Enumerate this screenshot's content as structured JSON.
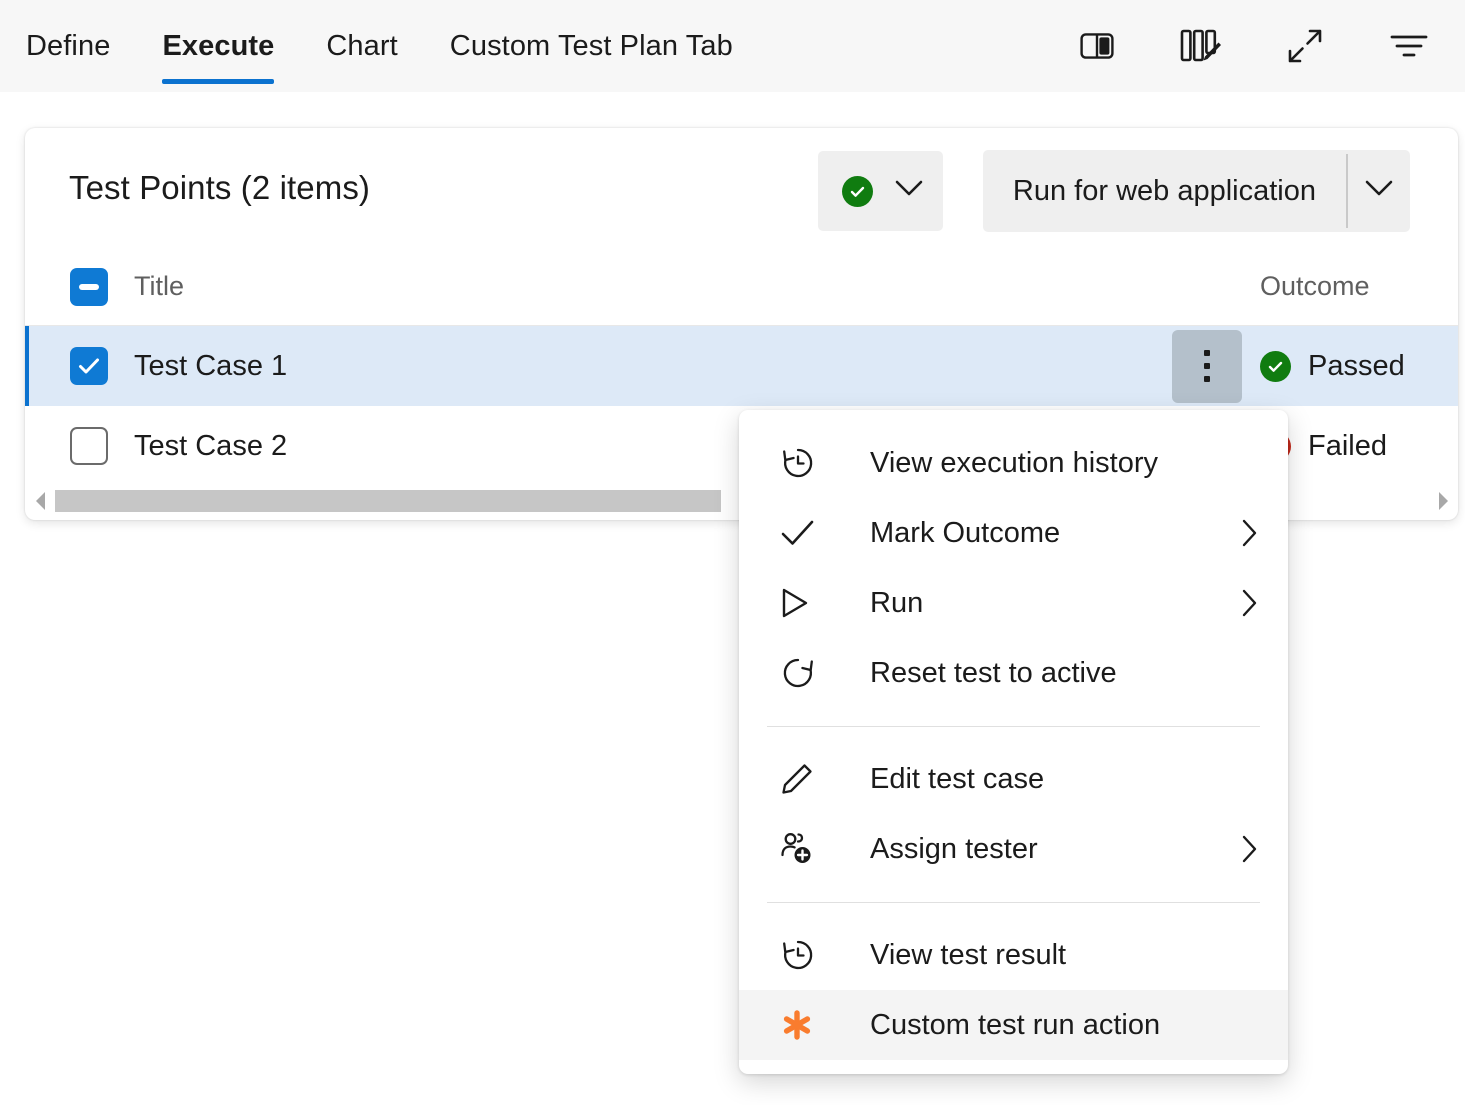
{
  "tabs": [
    {
      "label": "Define",
      "active": false
    },
    {
      "label": "Execute",
      "active": true
    },
    {
      "label": "Chart",
      "active": false
    },
    {
      "label": "Custom Test Plan Tab",
      "active": false
    }
  ],
  "toolbar": {
    "icons": [
      {
        "name": "split-pane-icon",
        "title": "Split pane"
      },
      {
        "name": "column-options-icon",
        "title": "Column options"
      },
      {
        "name": "fullscreen-expand-icon",
        "title": "Full screen"
      },
      {
        "name": "filter-icon",
        "title": "Filter"
      }
    ]
  },
  "card": {
    "title": "Test Points (2 items)",
    "outcome_button": {
      "icon": "passed-outcome-icon",
      "caret": "chevron-down-icon"
    },
    "run_button": {
      "label": "Run for web application",
      "caret": "chevron-down-icon"
    }
  },
  "grid": {
    "columns": {
      "select_all": "indeterminate",
      "title": "Title",
      "outcome": "Outcome"
    },
    "rows": [
      {
        "title": "Test Case 1",
        "checked": true,
        "selected": true,
        "outcome": "Passed",
        "outcome_state": "passed",
        "kebab": "more-actions-icon"
      },
      {
        "title": "Test Case 2",
        "checked": false,
        "selected": false,
        "outcome": "Failed",
        "outcome_state": "failed",
        "kebab": "more-actions-icon"
      }
    ],
    "scrollbar": {
      "left_arrow": "scroll-left-icon",
      "right_arrow": "scroll-right-icon"
    }
  },
  "context_menu": {
    "items": [
      {
        "label": "View execution history",
        "icon": "history-icon",
        "submenu": false,
        "highlighted": false
      },
      {
        "label": "Mark Outcome",
        "icon": "checkmark-icon",
        "submenu": true,
        "highlighted": false
      },
      {
        "label": "Run",
        "icon": "play-icon",
        "submenu": true,
        "highlighted": false
      },
      {
        "label": "Reset test to active",
        "icon": "refresh-icon",
        "submenu": false,
        "highlighted": false
      },
      {
        "separator": true
      },
      {
        "label": "Edit test case",
        "icon": "pencil-icon",
        "submenu": false,
        "highlighted": false
      },
      {
        "label": "Assign tester",
        "icon": "person-add-icon",
        "submenu": true,
        "highlighted": false
      },
      {
        "separator": true
      },
      {
        "label": "View test result",
        "icon": "history-icon",
        "submenu": false,
        "highlighted": false
      },
      {
        "label": "Custom test run action",
        "icon": "asterisk-icon",
        "submenu": false,
        "highlighted": true
      }
    ]
  },
  "colors": {
    "accent": "#0b72cf",
    "checkbox": "#0f7ad4",
    "selected_row": "#dde9f7",
    "passed": "#107c10",
    "failed": "#c42b1c",
    "custom_action": "#f97c2e",
    "toolbar_bg": "#f7f7f7",
    "button_bg": "#efefef"
  }
}
